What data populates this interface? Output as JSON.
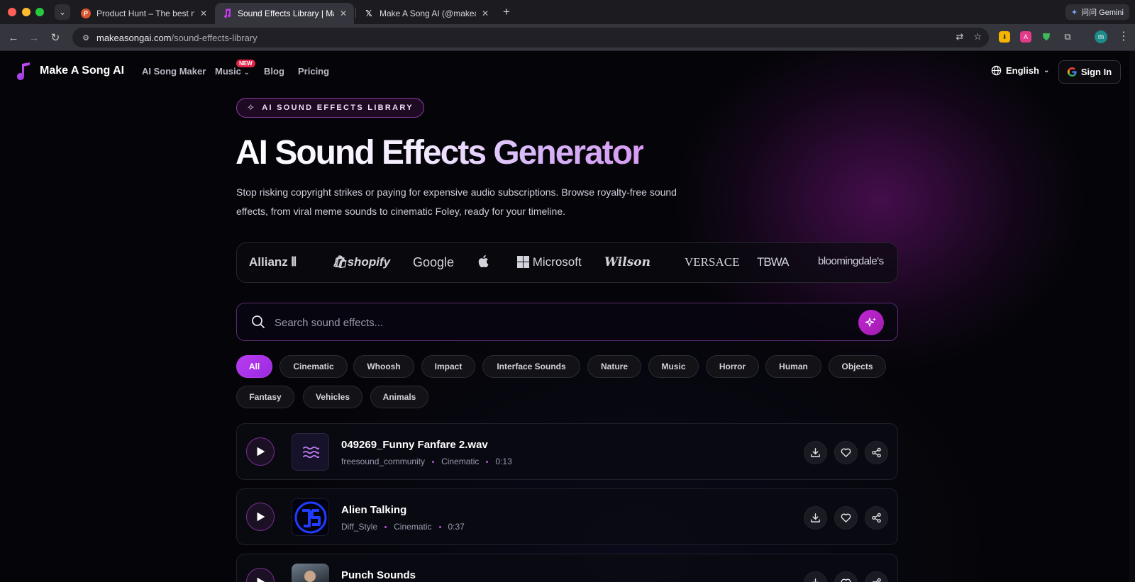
{
  "browser": {
    "tabs": [
      {
        "title": "Product Hunt – The best new",
        "favicon_color": "#da552f"
      },
      {
        "title": "Sound Effects Library | Make",
        "favicon_color": "#b23bd6"
      },
      {
        "title": "Make A Song AI (@makeasong",
        "favicon_color": "#000000"
      }
    ],
    "url_host": "makeasongai.com",
    "url_path": "/sound-effects-library",
    "gemini_label": "问问 Gemini",
    "profile_initial": "m"
  },
  "nav": {
    "brand": "Make A Song AI",
    "links": [
      "AI Song Maker",
      "Music",
      "Blog",
      "Pricing"
    ],
    "new_badge": "NEW",
    "language": "English",
    "sign_in": "Sign In"
  },
  "hero": {
    "tag": "AI SOUND EFFECTS LIBRARY",
    "title": "AI Sound Effects Generator",
    "description": "Stop risking copyright strikes or paying for expensive audio subscriptions. Browse royalty-free sound effects, from viral meme sounds to cinematic Foley, ready for your timeline."
  },
  "brands": [
    "Allianz",
    "shopify",
    "Google",
    "",
    "Microsoft",
    "Wilson",
    "VERSACE",
    "TBWA",
    "bloomingdale's"
  ],
  "search": {
    "placeholder": "Search sound effects..."
  },
  "categories": [
    "All",
    "Cinematic",
    "Whoosh",
    "Impact",
    "Interface Sounds",
    "Nature",
    "Music",
    "Horror",
    "Human",
    "Objects",
    "Fantasy",
    "Vehicles",
    "Animals"
  ],
  "active_category": "All",
  "tracks": [
    {
      "title": "049269_Funny Fanfare 2.wav",
      "author": "freesound_community",
      "category": "Cinematic",
      "duration": "0:13",
      "thumb": "waves-icon"
    },
    {
      "title": "Alien Talking",
      "author": "Diff_Style",
      "category": "Cinematic",
      "duration": "0:37",
      "thumb": "logo-ds"
    },
    {
      "title": "Punch Sounds",
      "author": "",
      "category": "",
      "duration": "",
      "thumb": "photo-fighter"
    }
  ],
  "colors": {
    "accent": "#b83bf0",
    "background": "#050509"
  }
}
